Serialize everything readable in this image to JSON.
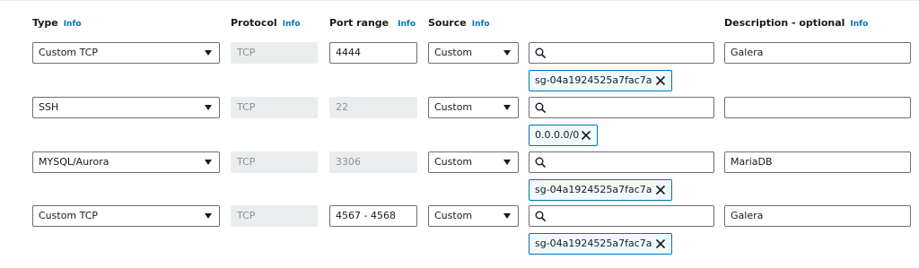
{
  "headers": {
    "type": "Type",
    "protocol": "Protocol",
    "port_range": "Port range",
    "source": "Source",
    "description": "Description - optional",
    "info": "Info"
  },
  "rules": [
    {
      "type": "Custom TCP",
      "protocol": "TCP",
      "port_range": "4444",
      "port_editable": true,
      "source": "Custom",
      "search_value": "",
      "token": "sg-04a1924525a7fac7a",
      "description": "Galera"
    },
    {
      "type": "SSH",
      "protocol": "TCP",
      "port_range": "22",
      "port_editable": false,
      "source": "Custom",
      "search_value": "",
      "token": "0.0.0.0/0",
      "description": ""
    },
    {
      "type": "MYSQL/Aurora",
      "protocol": "TCP",
      "port_range": "3306",
      "port_editable": false,
      "source": "Custom",
      "search_value": "",
      "token": "sg-04a1924525a7fac7a",
      "description": "MariaDB"
    },
    {
      "type": "Custom TCP",
      "protocol": "TCP",
      "port_range": "4567 - 4568",
      "port_editable": true,
      "source": "Custom",
      "search_value": "",
      "token": "sg-04a1924525a7fac7a",
      "description": "Galera"
    }
  ],
  "icons": {
    "search": "search-icon",
    "remove": "close-icon",
    "dropdown": "chevron-down-icon"
  },
  "colors": {
    "link": "#0073bb",
    "border": "#687078",
    "disabled_bg": "#eaeded",
    "token_bg": "#f1faff"
  }
}
